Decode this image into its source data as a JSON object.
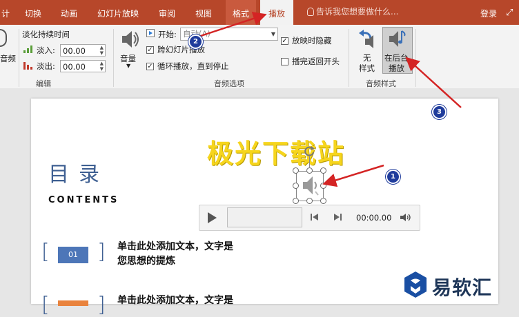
{
  "tabs": {
    "partial": "计",
    "transitions": "切换",
    "animations": "动画",
    "slideshow": "幻灯片放映",
    "review": "审阅",
    "view": "视图",
    "format": "格式",
    "playback": "播放"
  },
  "tellme": "告诉我您想要做什么...",
  "login": "登录",
  "ribbon": {
    "audio_partial": "音频",
    "fade_duration": "淡化持续时间",
    "fade_in_label": "淡入:",
    "fade_in_value": "00.00",
    "fade_out_label": "淡出:",
    "fade_out_value": "00.00",
    "group_edit": "编辑",
    "volume": "音量",
    "start_label": "开始:",
    "start_value": "自动(A)",
    "play_across": "跨幻灯片播放",
    "loop": "循环播放，直到停止",
    "hide_during_show": "放映时隐藏",
    "rewind": "播完返回开头",
    "group_audio_options": "音频选项",
    "no_style_1": "无",
    "no_style_2": "样式",
    "bg_play_1": "在后台",
    "bg_play_2": "播放",
    "group_audio_styles": "音频样式"
  },
  "slide": {
    "title": "极光下载站",
    "toc": "目录",
    "contents": "CONTENTS",
    "items": [
      {
        "num": "01",
        "line1": "单击此处添加文本，文字是",
        "line2": "您思想的提炼"
      },
      {
        "num": "",
        "line1": "单击此处添加文本，文字是",
        "line2": ""
      }
    ]
  },
  "player": {
    "time": "00:00.00"
  },
  "watermark": "易软汇",
  "badges": [
    "1",
    "2",
    "3"
  ],
  "colors": {
    "accent": "#b7472a",
    "toc_blue": "#3e5f92",
    "title_yellow": "#f6d51d",
    "box_blue": "#4d76b8",
    "box_orange": "#e9833d",
    "badge": "#1f3c9c"
  }
}
